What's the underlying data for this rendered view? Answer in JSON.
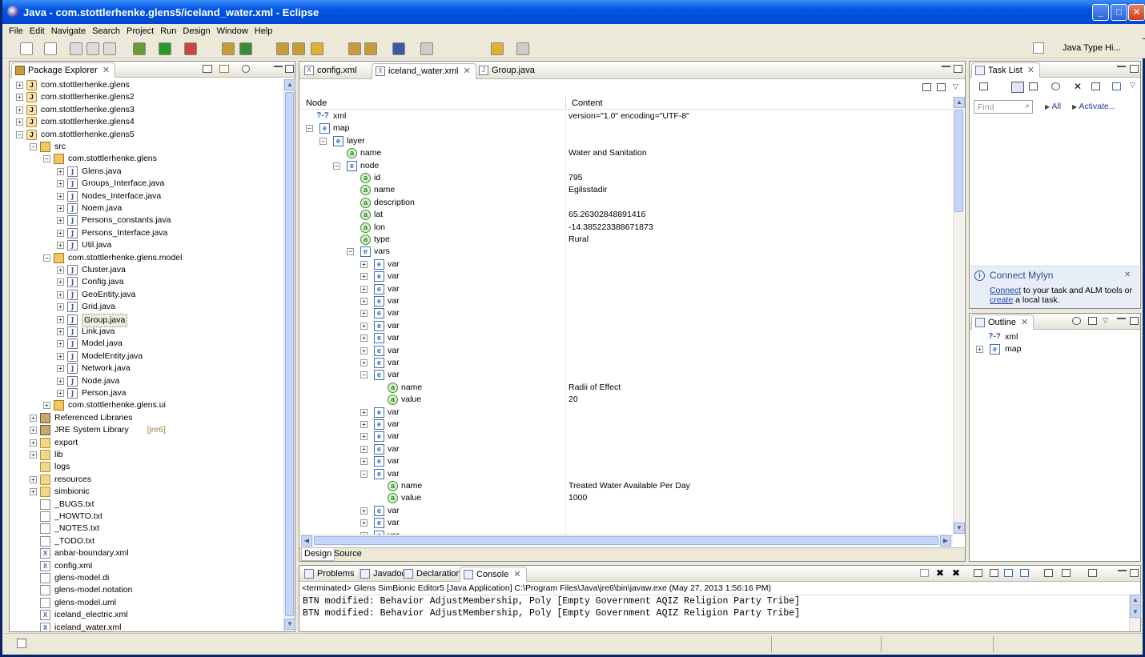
{
  "window": {
    "title": "Java - com.stottlerhenke.glens5/iceland_water.xml - Eclipse"
  },
  "menu": [
    "File",
    "Edit",
    "Navigate",
    "Search",
    "Project",
    "Run",
    "Design",
    "Window",
    "Help"
  ],
  "perspective": {
    "label": "Java Type Hi..."
  },
  "package_explorer": {
    "title": "Package Explorer",
    "rows": [
      {
        "d": 0,
        "exp": "+",
        "icon": "proj",
        "label": "com.stottlerhenke.glens"
      },
      {
        "d": 0,
        "exp": "+",
        "icon": "proj",
        "label": "com.stottlerhenke.glens2"
      },
      {
        "d": 0,
        "exp": "+",
        "icon": "proj",
        "label": "com.stottlerhenke.glens3"
      },
      {
        "d": 0,
        "exp": "+",
        "icon": "proj",
        "label": "com.stottlerhenke.glens4"
      },
      {
        "d": 0,
        "exp": "-",
        "icon": "proj",
        "label": "com.stottlerhenke.glens5"
      },
      {
        "d": 1,
        "exp": "-",
        "icon": "pkg",
        "label": "src"
      },
      {
        "d": 2,
        "exp": "-",
        "icon": "pkg",
        "label": "com.stottlerhenke.glens"
      },
      {
        "d": 3,
        "exp": "+",
        "icon": "java",
        "label": "Glens.java"
      },
      {
        "d": 3,
        "exp": "+",
        "icon": "java",
        "label": "Groups_Interface.java"
      },
      {
        "d": 3,
        "exp": "+",
        "icon": "java",
        "label": "Nodes_Interface.java"
      },
      {
        "d": 3,
        "exp": "+",
        "icon": "java",
        "label": "Noem.java"
      },
      {
        "d": 3,
        "exp": "+",
        "icon": "java",
        "label": "Persons_constants.java"
      },
      {
        "d": 3,
        "exp": "+",
        "icon": "java",
        "label": "Persons_Interface.java"
      },
      {
        "d": 3,
        "exp": "+",
        "icon": "java",
        "label": "Util.java"
      },
      {
        "d": 2,
        "exp": "-",
        "icon": "pkg",
        "label": "com.stottlerhenke.glens.model"
      },
      {
        "d": 3,
        "exp": "+",
        "icon": "java",
        "label": "Cluster.java"
      },
      {
        "d": 3,
        "exp": "+",
        "icon": "java",
        "label": "Config.java"
      },
      {
        "d": 3,
        "exp": "+",
        "icon": "java",
        "label": "GeoEntity.java"
      },
      {
        "d": 3,
        "exp": "+",
        "icon": "java",
        "label": "Grid.java"
      },
      {
        "d": 3,
        "exp": "+",
        "icon": "java",
        "label": "Group.java",
        "selected": true
      },
      {
        "d": 3,
        "exp": "+",
        "icon": "java",
        "label": "Link.java"
      },
      {
        "d": 3,
        "exp": "+",
        "icon": "java",
        "label": "Model.java"
      },
      {
        "d": 3,
        "exp": "+",
        "icon": "java",
        "label": "ModelEntity.java"
      },
      {
        "d": 3,
        "exp": "+",
        "icon": "java",
        "label": "Network.java"
      },
      {
        "d": 3,
        "exp": "+",
        "icon": "java",
        "label": "Node.java"
      },
      {
        "d": 3,
        "exp": "+",
        "icon": "java",
        "label": "Person.java"
      },
      {
        "d": 2,
        "exp": "+",
        "icon": "pkg",
        "label": "com.stottlerhenke.glens.ui"
      },
      {
        "d": 1,
        "exp": "+",
        "icon": "lib",
        "label": "Referenced Libraries"
      },
      {
        "d": 1,
        "exp": "+",
        "icon": "lib",
        "label": "JRE System Library",
        "suffix": "[jre6]"
      },
      {
        "d": 1,
        "exp": "+",
        "icon": "folder",
        "label": "export"
      },
      {
        "d": 1,
        "exp": "+",
        "icon": "folder",
        "label": "lib"
      },
      {
        "d": 1,
        "exp": "",
        "icon": "folder",
        "label": "logs"
      },
      {
        "d": 1,
        "exp": "+",
        "icon": "folder",
        "label": "resources"
      },
      {
        "d": 1,
        "exp": "+",
        "icon": "folder",
        "label": "simbionic"
      },
      {
        "d": 1,
        "exp": "",
        "icon": "file",
        "label": "_BUGS.txt"
      },
      {
        "d": 1,
        "exp": "",
        "icon": "file",
        "label": "_HOWTO.txt"
      },
      {
        "d": 1,
        "exp": "",
        "icon": "file",
        "label": "_NOTES.txt"
      },
      {
        "d": 1,
        "exp": "",
        "icon": "file",
        "label": "_TODO.txt"
      },
      {
        "d": 1,
        "exp": "",
        "icon": "xmlf",
        "label": "anbar-boundary.xml"
      },
      {
        "d": 1,
        "exp": "",
        "icon": "xmlf",
        "label": "config.xml"
      },
      {
        "d": 1,
        "exp": "",
        "icon": "file",
        "label": "glens-model.di"
      },
      {
        "d": 1,
        "exp": "",
        "icon": "file",
        "label": "glens-model.notation"
      },
      {
        "d": 1,
        "exp": "",
        "icon": "file",
        "label": "glens-model.uml"
      },
      {
        "d": 1,
        "exp": "",
        "icon": "xmlf",
        "label": "iceland_electric.xml"
      },
      {
        "d": 1,
        "exp": "",
        "icon": "xmlf",
        "label": "iceland_water.xml"
      }
    ]
  },
  "editor": {
    "tabs": [
      {
        "label": "config.xml",
        "icon": "X"
      },
      {
        "label": "iceland_water.xml",
        "icon": "X",
        "active": true
      },
      {
        "label": "Group.java",
        "icon": "J"
      }
    ],
    "columns": [
      "Node",
      "Content"
    ],
    "rows": [
      {
        "d": 0,
        "exp": "",
        "icon": "pi",
        "node": "xml",
        "content": "version=\"1.0\" encoding=\"UTF-8\""
      },
      {
        "d": 0,
        "exp": "-",
        "icon": "el",
        "node": "map",
        "content": ""
      },
      {
        "d": 1,
        "exp": "-",
        "icon": "el",
        "node": "layer",
        "content": ""
      },
      {
        "d": 2,
        "exp": "",
        "icon": "at",
        "node": "name",
        "content": "Water and Sanitation"
      },
      {
        "d": 2,
        "exp": "-",
        "icon": "el",
        "node": "node",
        "content": ""
      },
      {
        "d": 3,
        "exp": "",
        "icon": "at",
        "node": "id",
        "content": "795"
      },
      {
        "d": 3,
        "exp": "",
        "icon": "at",
        "node": "name",
        "content": "Egilsstadir"
      },
      {
        "d": 3,
        "exp": "",
        "icon": "at",
        "node": "description",
        "content": ""
      },
      {
        "d": 3,
        "exp": "",
        "icon": "at",
        "node": "lat",
        "content": "65.26302848891416"
      },
      {
        "d": 3,
        "exp": "",
        "icon": "at",
        "node": "lon",
        "content": "-14.385223388671873"
      },
      {
        "d": 3,
        "exp": "",
        "icon": "at",
        "node": "type",
        "content": "Rural"
      },
      {
        "d": 3,
        "exp": "-",
        "icon": "el",
        "node": "vars",
        "content": ""
      },
      {
        "d": 4,
        "exp": "+",
        "icon": "el",
        "node": "var",
        "content": ""
      },
      {
        "d": 4,
        "exp": "+",
        "icon": "el",
        "node": "var",
        "content": ""
      },
      {
        "d": 4,
        "exp": "+",
        "icon": "el",
        "node": "var",
        "content": ""
      },
      {
        "d": 4,
        "exp": "+",
        "icon": "el",
        "node": "var",
        "content": ""
      },
      {
        "d": 4,
        "exp": "+",
        "icon": "el",
        "node": "var",
        "content": ""
      },
      {
        "d": 4,
        "exp": "+",
        "icon": "el",
        "node": "var",
        "content": ""
      },
      {
        "d": 4,
        "exp": "+",
        "icon": "el",
        "node": "var",
        "content": ""
      },
      {
        "d": 4,
        "exp": "+",
        "icon": "el",
        "node": "var",
        "content": ""
      },
      {
        "d": 4,
        "exp": "+",
        "icon": "el",
        "node": "var",
        "content": ""
      },
      {
        "d": 4,
        "exp": "-",
        "icon": "el",
        "node": "var",
        "content": ""
      },
      {
        "d": 5,
        "exp": "",
        "icon": "at",
        "node": "name",
        "content": "Radii of Effect"
      },
      {
        "d": 5,
        "exp": "",
        "icon": "at",
        "node": "value",
        "content": "20"
      },
      {
        "d": 4,
        "exp": "+",
        "icon": "el",
        "node": "var",
        "content": ""
      },
      {
        "d": 4,
        "exp": "+",
        "icon": "el",
        "node": "var",
        "content": ""
      },
      {
        "d": 4,
        "exp": "+",
        "icon": "el",
        "node": "var",
        "content": ""
      },
      {
        "d": 4,
        "exp": "+",
        "icon": "el",
        "node": "var",
        "content": ""
      },
      {
        "d": 4,
        "exp": "+",
        "icon": "el",
        "node": "var",
        "content": ""
      },
      {
        "d": 4,
        "exp": "-",
        "icon": "el",
        "node": "var",
        "content": ""
      },
      {
        "d": 5,
        "exp": "",
        "icon": "at",
        "node": "name",
        "content": "Treated Water Available Per Day"
      },
      {
        "d": 5,
        "exp": "",
        "icon": "at",
        "node": "value",
        "content": "1000"
      },
      {
        "d": 4,
        "exp": "+",
        "icon": "el",
        "node": "var",
        "content": ""
      },
      {
        "d": 4,
        "exp": "+",
        "icon": "el",
        "node": "var",
        "content": ""
      },
      {
        "d": 4,
        "exp": "+",
        "icon": "el",
        "node": "var",
        "content": ""
      }
    ],
    "bottom_tabs": [
      "Design",
      "Source"
    ]
  },
  "task_list": {
    "title": "Task List",
    "find_placeholder": "Find",
    "all_label": "All",
    "activate_label": "Activate...",
    "mylyn_title": "Connect Mylyn",
    "mylyn_link1": "Connect",
    "mylyn_text1": " to your task and ALM tools or",
    "mylyn_link2": "create",
    "mylyn_text2": " a local task."
  },
  "outline": {
    "title": "Outline",
    "rows": [
      {
        "exp": "",
        "icon": "pi",
        "label": "xml"
      },
      {
        "exp": "+",
        "icon": "el",
        "label": "map"
      }
    ]
  },
  "console": {
    "tabs": [
      "Problems",
      "Javadoc",
      "Declaration",
      "Console"
    ],
    "header": "<terminated> Glens SimBionic Editor5 [Java Application] C:\\Program Files\\Java\\jre6\\bin\\javaw.exe (May 27, 2013 1:56:16 PM)",
    "lines": [
      "BTN modified: Behavior AdjustMembership, Poly [Empty Government AQIZ Religion Party Tribe]",
      "BTN modified: Behavior AdjustMembership, Poly [Empty Government AQIZ Religion Party Tribe]"
    ]
  }
}
